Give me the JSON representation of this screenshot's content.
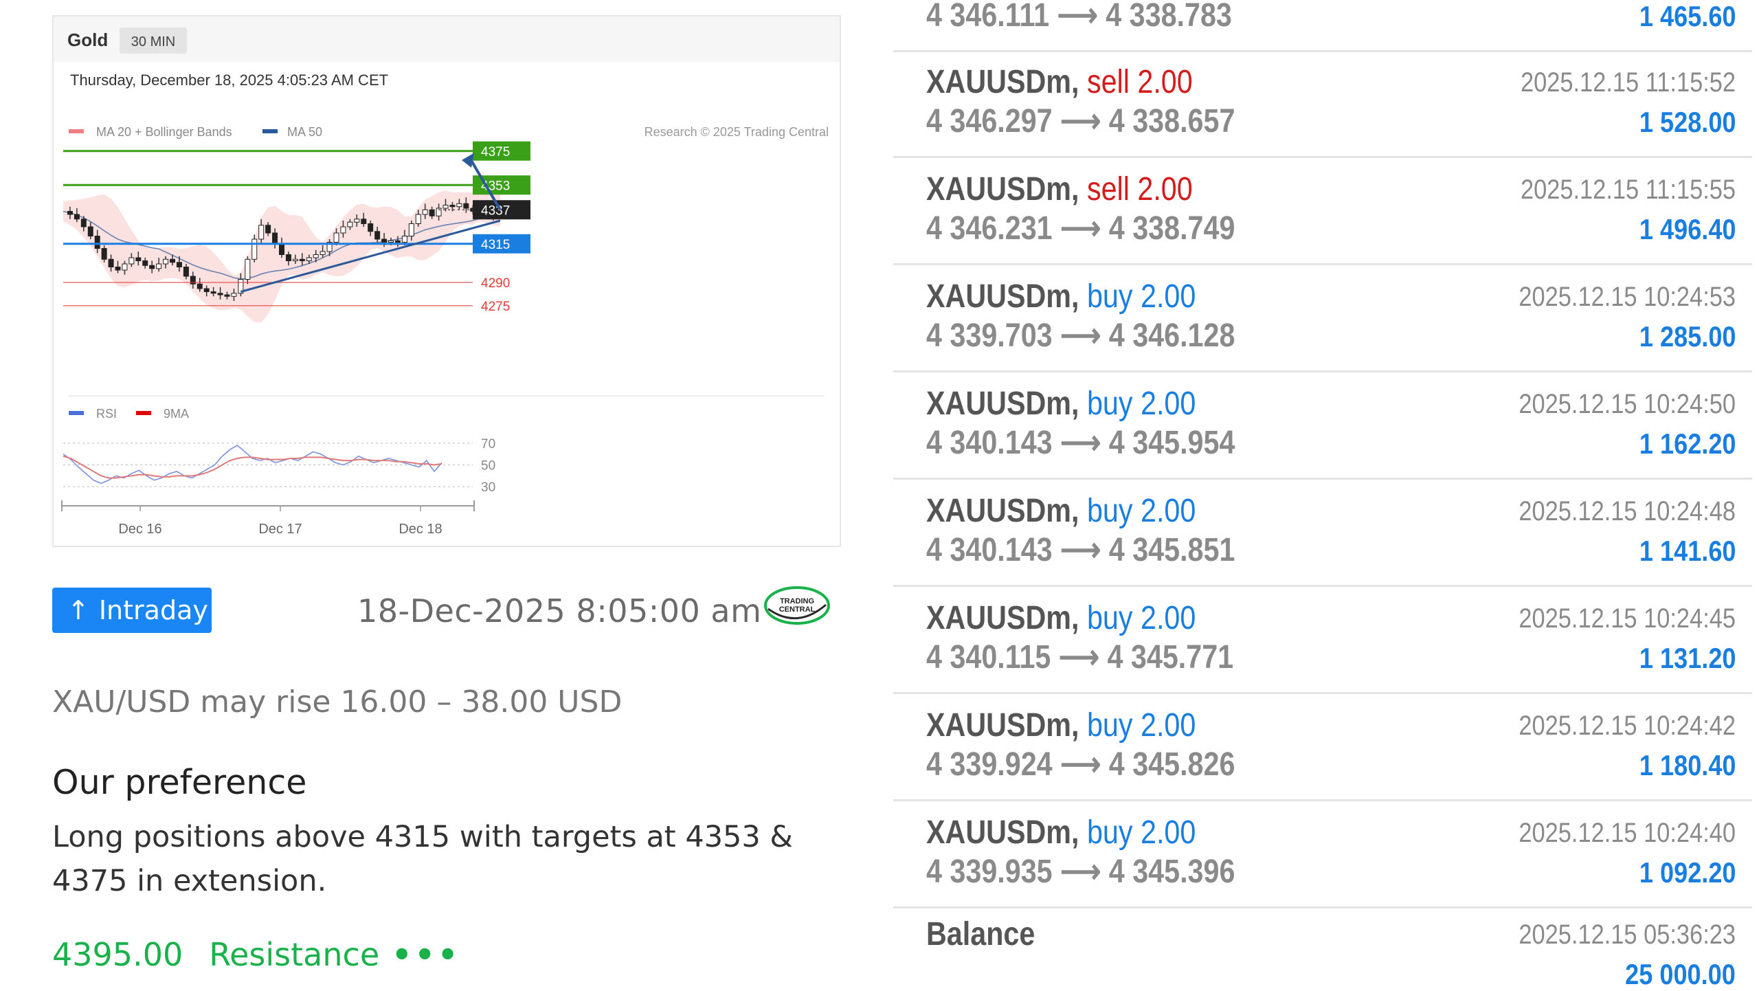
{
  "chart": {
    "instrument": "Gold",
    "timeframe": "30 MIN",
    "datetime": "Thursday, December 18, 2025 4:05:23 AM CET",
    "legend_ma20": "MA 20 + Bollinger Bands",
    "legend_ma50": "MA 50",
    "copyright": "Research © 2025 Trading Central",
    "rsi_legend": "RSI",
    "rsi_ma_legend": "9MA",
    "colors": {
      "ma20": "#f08080",
      "ma50": "#2a5a9a",
      "resistance": "#3aa017",
      "support": "#1a7ee0",
      "current": "#222222",
      "minor": "#e23b3b"
    }
  },
  "chart_data": {
    "type": "line",
    "x_ticks": [
      "Dec 16",
      "Dec 17",
      "Dec 18"
    ],
    "levels": [
      {
        "value": 4375,
        "label": "4375",
        "kind": "resistance"
      },
      {
        "value": 4353,
        "label": "4353",
        "kind": "resistance"
      },
      {
        "value": 4337,
        "label": "4337",
        "kind": "current"
      },
      {
        "value": 4315,
        "label": "4315",
        "kind": "pivot"
      },
      {
        "value": 4290,
        "label": "4290",
        "kind": "support"
      },
      {
        "value": 4275,
        "label": "4275",
        "kind": "support"
      }
    ],
    "ylim": [
      4262,
      4382
    ],
    "price_close": [
      4336,
      4334,
      4331,
      4326,
      4320,
      4312,
      4305,
      4300,
      4298,
      4302,
      4306,
      4304,
      4301,
      4299,
      4302,
      4305,
      4303,
      4300,
      4294,
      4289,
      4286,
      4284,
      4283,
      4282,
      4281,
      4283,
      4292,
      4305,
      4318,
      4327,
      4322,
      4315,
      4308,
      4304,
      4305,
      4304,
      4306,
      4308,
      4310,
      4316,
      4322,
      4326,
      4329,
      4331,
      4328,
      4323,
      4318,
      4316,
      4317,
      4316,
      4320,
      4328,
      4334,
      4337,
      4333,
      4338,
      4340,
      4339,
      4341,
      4338,
      4336,
      4337,
      4335,
      4333,
      4337
    ],
    "rsi_ticks": [
      70,
      50,
      30
    ],
    "rsi_ylim": [
      20,
      80
    ],
    "rsi": [
      60,
      55,
      48,
      42,
      36,
      33,
      36,
      40,
      38,
      42,
      45,
      40,
      36,
      38,
      42,
      44,
      40,
      38,
      42,
      46,
      50,
      58,
      64,
      68,
      62,
      56,
      54,
      56,
      52,
      54,
      56,
      54,
      58,
      62,
      60,
      56,
      52,
      50,
      53,
      58,
      55,
      52,
      54,
      56,
      54,
      52,
      50,
      48,
      54,
      44,
      52
    ],
    "rsi_ma": [
      58,
      56,
      52,
      48,
      44,
      40,
      38,
      38,
      39,
      40,
      41,
      41,
      40,
      39,
      39,
      40,
      40,
      40,
      41,
      43,
      46,
      50,
      54,
      56,
      57,
      57,
      56,
      55,
      55,
      55,
      56,
      56,
      57,
      57,
      57,
      56,
      55,
      54,
      54,
      55,
      55,
      54,
      54,
      54,
      53,
      53,
      52,
      51,
      51,
      50,
      51
    ]
  },
  "signal": {
    "badge": "Intraday",
    "date": "18-Dec-2025 8:05:00 am",
    "logo_line1": "TRADING",
    "logo_line2": "CENTRAL",
    "headline": "XAU/USD may rise 16.00 – 38.00 USD",
    "preference_title": "Our preference",
    "preference_text": "Long positions above 4315 with targets at 4353 & 4375 in extension.",
    "level_value": "4395.00",
    "level_label": "Resistance",
    "level_more": "•••"
  },
  "trades": [
    {
      "symbol": "",
      "side": "",
      "volume": "",
      "open": "4 346.111",
      "close": "4 338.783",
      "time": "",
      "profit": "1 465.60"
    },
    {
      "symbol": "XAUUSDm,",
      "side": "sell",
      "volume": "2.00",
      "open": "4 346.297",
      "close": "4 338.657",
      "time": "2025.12.15 11:15:52",
      "profit": "1 528.00"
    },
    {
      "symbol": "XAUUSDm,",
      "side": "sell",
      "volume": "2.00",
      "open": "4 346.231",
      "close": "4 338.749",
      "time": "2025.12.15 11:15:55",
      "profit": "1 496.40"
    },
    {
      "symbol": "XAUUSDm,",
      "side": "buy",
      "volume": "2.00",
      "open": "4 339.703",
      "close": "4 346.128",
      "time": "2025.12.15 10:24:53",
      "profit": "1 285.00"
    },
    {
      "symbol": "XAUUSDm,",
      "side": "buy",
      "volume": "2.00",
      "open": "4 340.143",
      "close": "4 345.954",
      "time": "2025.12.15 10:24:50",
      "profit": "1 162.20"
    },
    {
      "symbol": "XAUUSDm,",
      "side": "buy",
      "volume": "2.00",
      "open": "4 340.143",
      "close": "4 345.851",
      "time": "2025.12.15 10:24:48",
      "profit": "1 141.60"
    },
    {
      "symbol": "XAUUSDm,",
      "side": "buy",
      "volume": "2.00",
      "open": "4 340.115",
      "close": "4 345.771",
      "time": "2025.12.15 10:24:45",
      "profit": "1 131.20"
    },
    {
      "symbol": "XAUUSDm,",
      "side": "buy",
      "volume": "2.00",
      "open": "4 339.924",
      "close": "4 345.826",
      "time": "2025.12.15 10:24:42",
      "profit": "1 180.40"
    },
    {
      "symbol": "XAUUSDm,",
      "side": "buy",
      "volume": "2.00",
      "open": "4 339.935",
      "close": "4 345.396",
      "time": "2025.12.15 10:24:40",
      "profit": "1 092.20"
    }
  ],
  "balance": {
    "label": "Balance",
    "time": "2025.12.15 05:36:23",
    "amount": "25 000.00"
  }
}
